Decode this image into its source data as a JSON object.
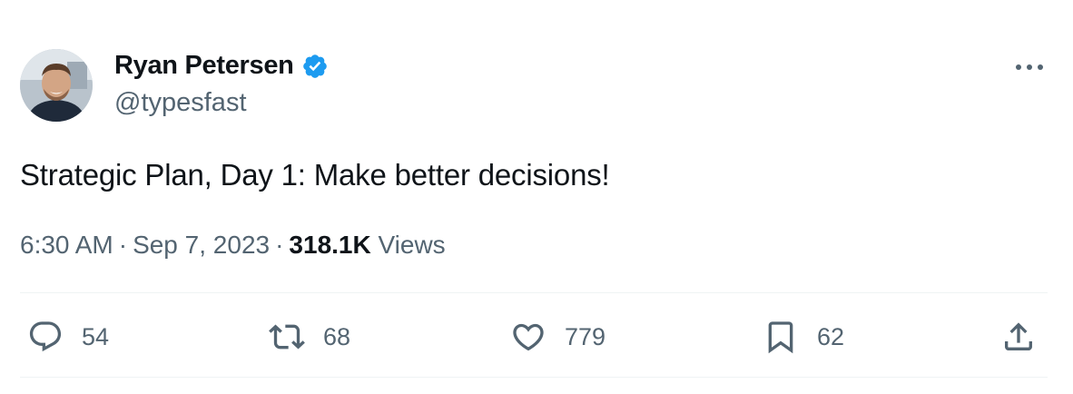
{
  "author": {
    "display_name": "Ryan Petersen",
    "handle": "@typesfast",
    "verified": true
  },
  "tweet": {
    "text": "Strategic Plan, Day 1: Make better decisions!",
    "time": "6:30 AM",
    "date": "Sep 7, 2023",
    "views_count": "318.1K",
    "views_label": "Views",
    "separator": "·"
  },
  "actions": {
    "reply_count": "54",
    "retweet_count": "68",
    "like_count": "779",
    "bookmark_count": "62"
  },
  "icons": {
    "more": "more-horizontal-icon",
    "verified": "verified-badge-icon",
    "reply": "reply-bubble-icon",
    "retweet": "retweet-icon",
    "like": "heart-icon",
    "bookmark": "bookmark-icon",
    "share": "share-upload-icon"
  },
  "colors": {
    "text_primary": "#0f1419",
    "text_secondary": "#536471",
    "verified_blue": "#1d9bf0",
    "divider": "#eff3f4"
  }
}
